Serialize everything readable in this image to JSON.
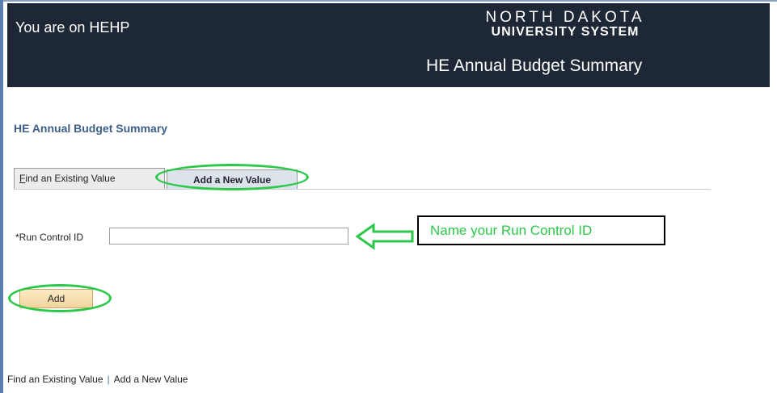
{
  "header": {
    "env_label": "You are on HEHP",
    "logo_line1": "NORTH DAKOTA",
    "logo_line2": "UNIVERSITY SYSTEM",
    "app_title": "HE Annual Budget Summary"
  },
  "page": {
    "title": "HE Annual Budget Summary"
  },
  "tabs": [
    {
      "label_first": "F",
      "label_rest": "ind an Existing Value",
      "active": false
    },
    {
      "label": "Add a New Value",
      "active": true
    }
  ],
  "form": {
    "run_control_label": "*Run Control ID",
    "run_control_value": ""
  },
  "callout": {
    "text": "Name your Run Control ID"
  },
  "buttons": {
    "add_label": "Add"
  },
  "bottom_links": {
    "find": "Find an Existing Value",
    "separator": "|",
    "add": "Add a New Value"
  },
  "colors": {
    "header_bg": "#1d2735",
    "title_blue": "#3d5f87",
    "highlight_green": "#2cc84a",
    "button_bg": "#f2d59d"
  }
}
